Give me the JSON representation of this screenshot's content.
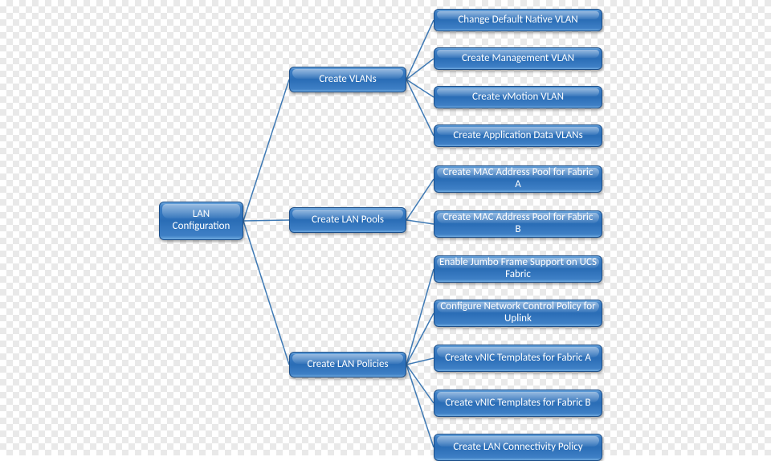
{
  "diagram": {
    "root": "LAN Configuration",
    "branches": [
      {
        "label": "Create VLANs",
        "children": [
          "Change Default Native VLAN",
          "Create Management VLAN",
          "Create vMotion VLAN",
          "Create Application Data VLANs"
        ]
      },
      {
        "label": "Create LAN Pools",
        "children": [
          "Create MAC Address Pool for Fabric A",
          "Create MAC Address Pool for Fabric B"
        ]
      },
      {
        "label": "Create LAN Policies",
        "children": [
          "Enable Jumbo Frame Support on UCS Fabric",
          "Configure Network Control Policy for Uplink",
          "Create vNIC Templates for Fabric A",
          "Create vNIC Templates for Fabric B",
          "Create LAN Connectivity Policy"
        ]
      }
    ]
  }
}
